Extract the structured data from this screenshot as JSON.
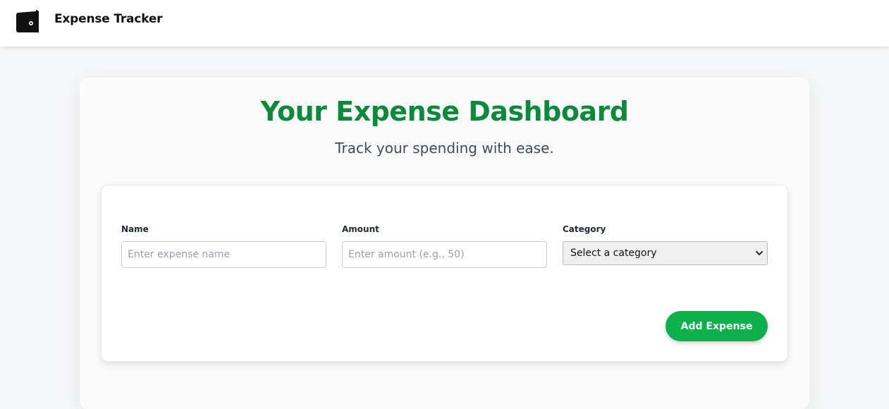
{
  "header": {
    "logo_icon": "wallet-icon",
    "brand": "Expense Tracker"
  },
  "dashboard": {
    "title": "Your Expense Dashboard",
    "subtitle": "Track your spending with ease."
  },
  "form": {
    "name": {
      "label": "Name",
      "placeholder": "Enter expense name",
      "value": ""
    },
    "amount": {
      "label": "Amount",
      "placeholder": "Enter amount (e.g., 50)",
      "value": ""
    },
    "category": {
      "label": "Category",
      "selected": "Select a category",
      "icon": "chevron-down-icon"
    },
    "submit_label": "Add Expense"
  },
  "colors": {
    "title": "#0b8a3c",
    "button": "#0db14b"
  }
}
